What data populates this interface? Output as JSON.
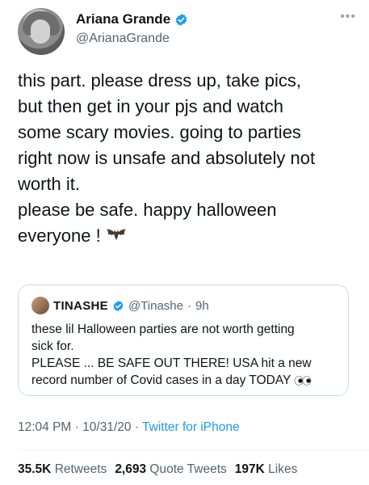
{
  "author": {
    "name": "Ariana Grande",
    "handle": "@ArianaGrande",
    "more_icon": "more-icon"
  },
  "tweet": {
    "text": "this part. please dress up, take pics,\nbut then get in your pjs and watch\nsome scary movies. going to parties\nright now is unsafe and absolutely not\nworth it.\nplease be safe. happy halloween\neveryone !",
    "emoji": "bat-emoji"
  },
  "quote": {
    "name": "TINASHE",
    "handle": "@Tinashe",
    "separator": "·",
    "time": "9h",
    "text": "these lil Halloween parties are not worth getting\nsick for.\nPLEASE ... BE SAFE OUT THERE! USA hit a new\nrecord number of Covid cases in a day TODAY",
    "emoji": "eyes-emoji"
  },
  "meta": {
    "time": "12:04 PM",
    "separator": "·",
    "date": "10/31/20",
    "source": "Twitter for iPhone"
  },
  "stats": {
    "retweets_count": "35.5K",
    "retweets_label": "Retweets",
    "quotes_count": "2,693",
    "quotes_label": "Quote Tweets",
    "likes_count": "197K",
    "likes_label": "Likes"
  },
  "colors": {
    "verified": "#1d9bf0",
    "link": "#1d9bf0",
    "muted": "#536471"
  }
}
